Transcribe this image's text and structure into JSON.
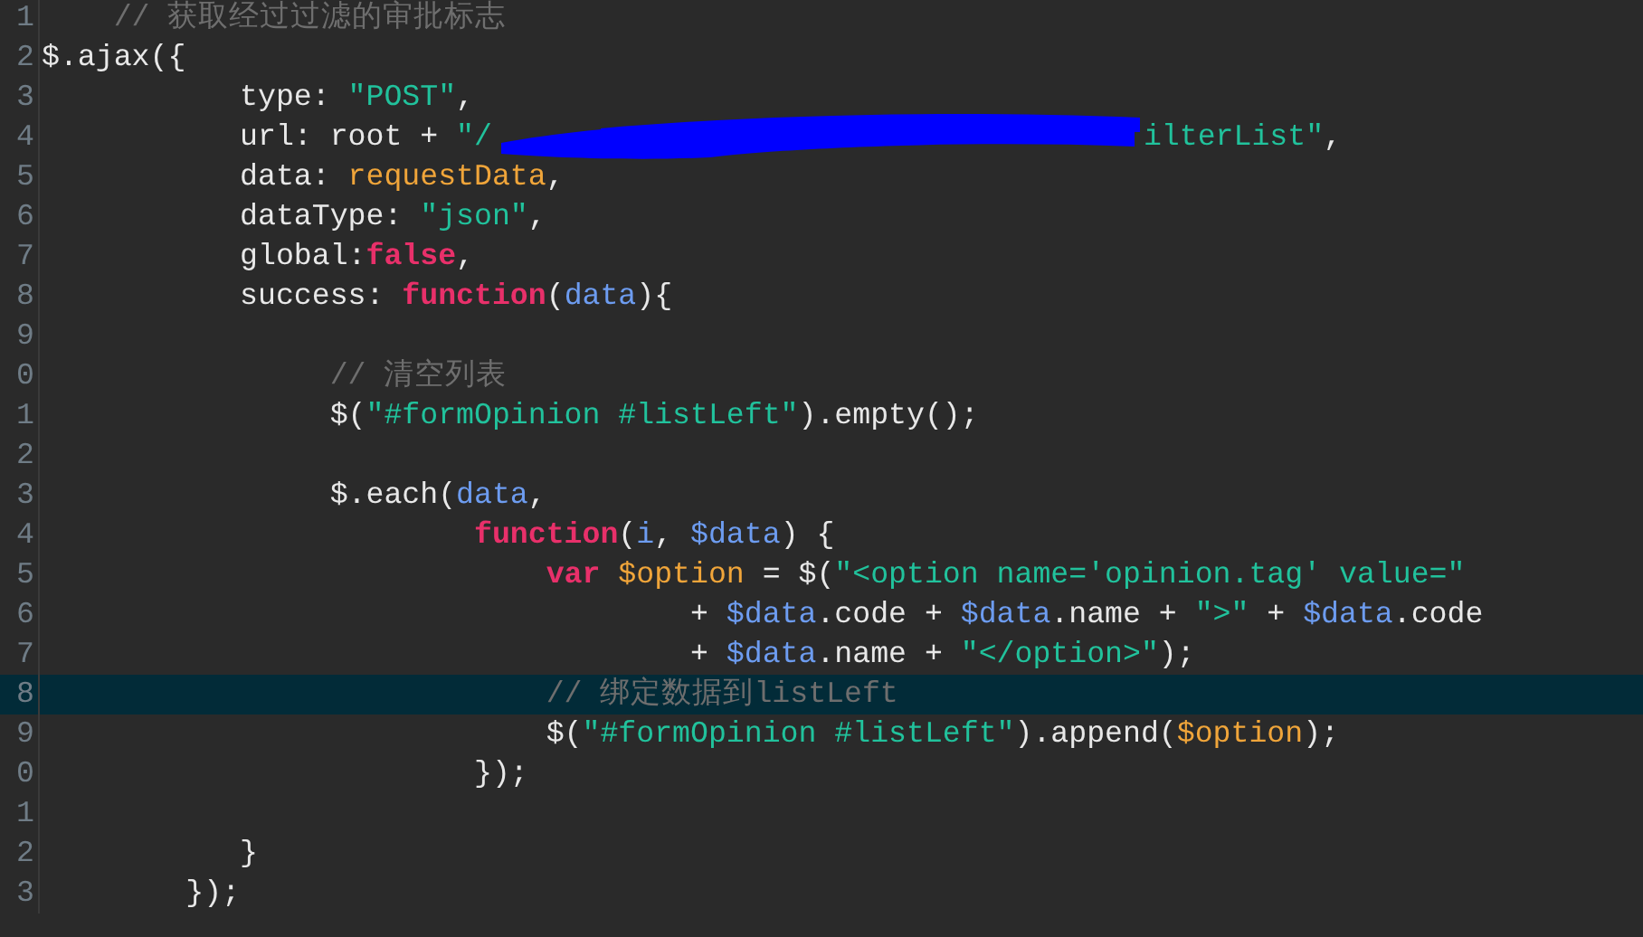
{
  "editor": {
    "lines": [
      {
        "number": "1",
        "current": false,
        "tokens": [
          {
            "text": "    // 获取经过过滤的审批标志",
            "kind": "comment"
          }
        ]
      },
      {
        "number": "2",
        "current": false,
        "tokens": [
          {
            "text": "$.ajax({",
            "kind": "plain"
          }
        ]
      },
      {
        "number": "3",
        "current": false,
        "tokens": [
          {
            "text": "           type: ",
            "kind": "plain"
          },
          {
            "text": "\"POST\"",
            "kind": "string"
          },
          {
            "text": ",",
            "kind": "plain"
          }
        ]
      },
      {
        "number": "4",
        "current": false,
        "tokens": [
          {
            "text": "           url: root + ",
            "kind": "plain"
          },
          {
            "text": "\"/",
            "kind": "string"
          },
          {
            "kind": "redaction"
          },
          {
            "text": "ilterList\"",
            "kind": "string"
          },
          {
            "text": ",",
            "kind": "plain"
          }
        ]
      },
      {
        "number": "5",
        "current": false,
        "tokens": [
          {
            "text": "           data: ",
            "kind": "plain"
          },
          {
            "text": "requestData",
            "kind": "variable"
          },
          {
            "text": ",",
            "kind": "plain"
          }
        ]
      },
      {
        "number": "6",
        "current": false,
        "tokens": [
          {
            "text": "           dataType: ",
            "kind": "plain"
          },
          {
            "text": "\"json\"",
            "kind": "string"
          },
          {
            "text": ",",
            "kind": "plain"
          }
        ]
      },
      {
        "number": "7",
        "current": false,
        "tokens": [
          {
            "text": "           global:",
            "kind": "plain"
          },
          {
            "text": "false",
            "kind": "keyword"
          },
          {
            "text": ",",
            "kind": "plain"
          }
        ]
      },
      {
        "number": "8",
        "current": false,
        "tokens": [
          {
            "text": "           success: ",
            "kind": "plain"
          },
          {
            "text": "function",
            "kind": "keyword"
          },
          {
            "text": "(",
            "kind": "plain"
          },
          {
            "text": "data",
            "kind": "param"
          },
          {
            "text": "){",
            "kind": "plain"
          }
        ]
      },
      {
        "number": "9",
        "current": false
      },
      {
        "number": "0",
        "current": false,
        "tokens": [
          {
            "text": "                // 清空列表",
            "kind": "comment"
          }
        ]
      },
      {
        "number": "1",
        "current": false,
        "tokens": [
          {
            "text": "                $(",
            "kind": "plain"
          },
          {
            "text": "\"#formOpinion #listLeft\"",
            "kind": "string"
          },
          {
            "text": ").empty();",
            "kind": "plain"
          }
        ]
      },
      {
        "number": "2",
        "current": false
      },
      {
        "number": "3",
        "current": false,
        "tokens": [
          {
            "text": "                $.each(",
            "kind": "plain"
          },
          {
            "text": "data",
            "kind": "param"
          },
          {
            "text": ",",
            "kind": "plain"
          }
        ]
      },
      {
        "number": "4",
        "current": false,
        "tokens": [
          {
            "text": "                        function",
            "kind": "keyword"
          },
          {
            "text": "(",
            "kind": "plain"
          },
          {
            "text": "i",
            "kind": "param"
          },
          {
            "text": ", ",
            "kind": "plain"
          },
          {
            "text": "$data",
            "kind": "param"
          },
          {
            "text": ") {",
            "kind": "plain"
          }
        ]
      },
      {
        "number": "5",
        "current": false,
        "tokens": [
          {
            "text": "                            var",
            "kind": "keyword"
          },
          {
            "text": " $option",
            "kind": "variable"
          },
          {
            "text": " = $(",
            "kind": "plain"
          },
          {
            "text": "\"<option name='opinion.tag' value=\"",
            "kind": "string"
          }
        ]
      },
      {
        "number": "6",
        "current": false,
        "tokens": [
          {
            "text": "                                    + ",
            "kind": "plain"
          },
          {
            "text": "$data",
            "kind": "param"
          },
          {
            "text": ".code + ",
            "kind": "plain"
          },
          {
            "text": "$data",
            "kind": "param"
          },
          {
            "text": ".name + ",
            "kind": "plain"
          },
          {
            "text": "\">\"",
            "kind": "string"
          },
          {
            "text": " + ",
            "kind": "plain"
          },
          {
            "text": "$data",
            "kind": "param"
          },
          {
            "text": ".code",
            "kind": "plain"
          }
        ]
      },
      {
        "number": "7",
        "current": false,
        "tokens": [
          {
            "text": "                                    + ",
            "kind": "plain"
          },
          {
            "text": "$data",
            "kind": "param"
          },
          {
            "text": ".name + ",
            "kind": "plain"
          },
          {
            "text": "\"</option>\"",
            "kind": "string"
          },
          {
            "text": ");",
            "kind": "plain"
          }
        ]
      },
      {
        "number": "8",
        "current": true,
        "tokens": [
          {
            "text": "                            // 绑定数据到listLeft",
            "kind": "comment"
          }
        ]
      },
      {
        "number": "9",
        "current": false,
        "tokens": [
          {
            "text": "                            $(",
            "kind": "plain"
          },
          {
            "text": "\"#formOpinion #listLeft\"",
            "kind": "string"
          },
          {
            "text": ").append(",
            "kind": "plain"
          },
          {
            "text": "$option",
            "kind": "variable"
          },
          {
            "text": ");",
            "kind": "plain"
          }
        ]
      },
      {
        "number": "0",
        "current": false,
        "tokens": [
          {
            "text": "                        });",
            "kind": "plain"
          }
        ]
      },
      {
        "number": "1",
        "current": false
      },
      {
        "number": "2",
        "current": false,
        "tokens": [
          {
            "text": "           }",
            "kind": "plain"
          }
        ]
      },
      {
        "number": "3",
        "current": false,
        "tokens": [
          {
            "text": "        });",
            "kind": "plain"
          }
        ]
      }
    ]
  }
}
